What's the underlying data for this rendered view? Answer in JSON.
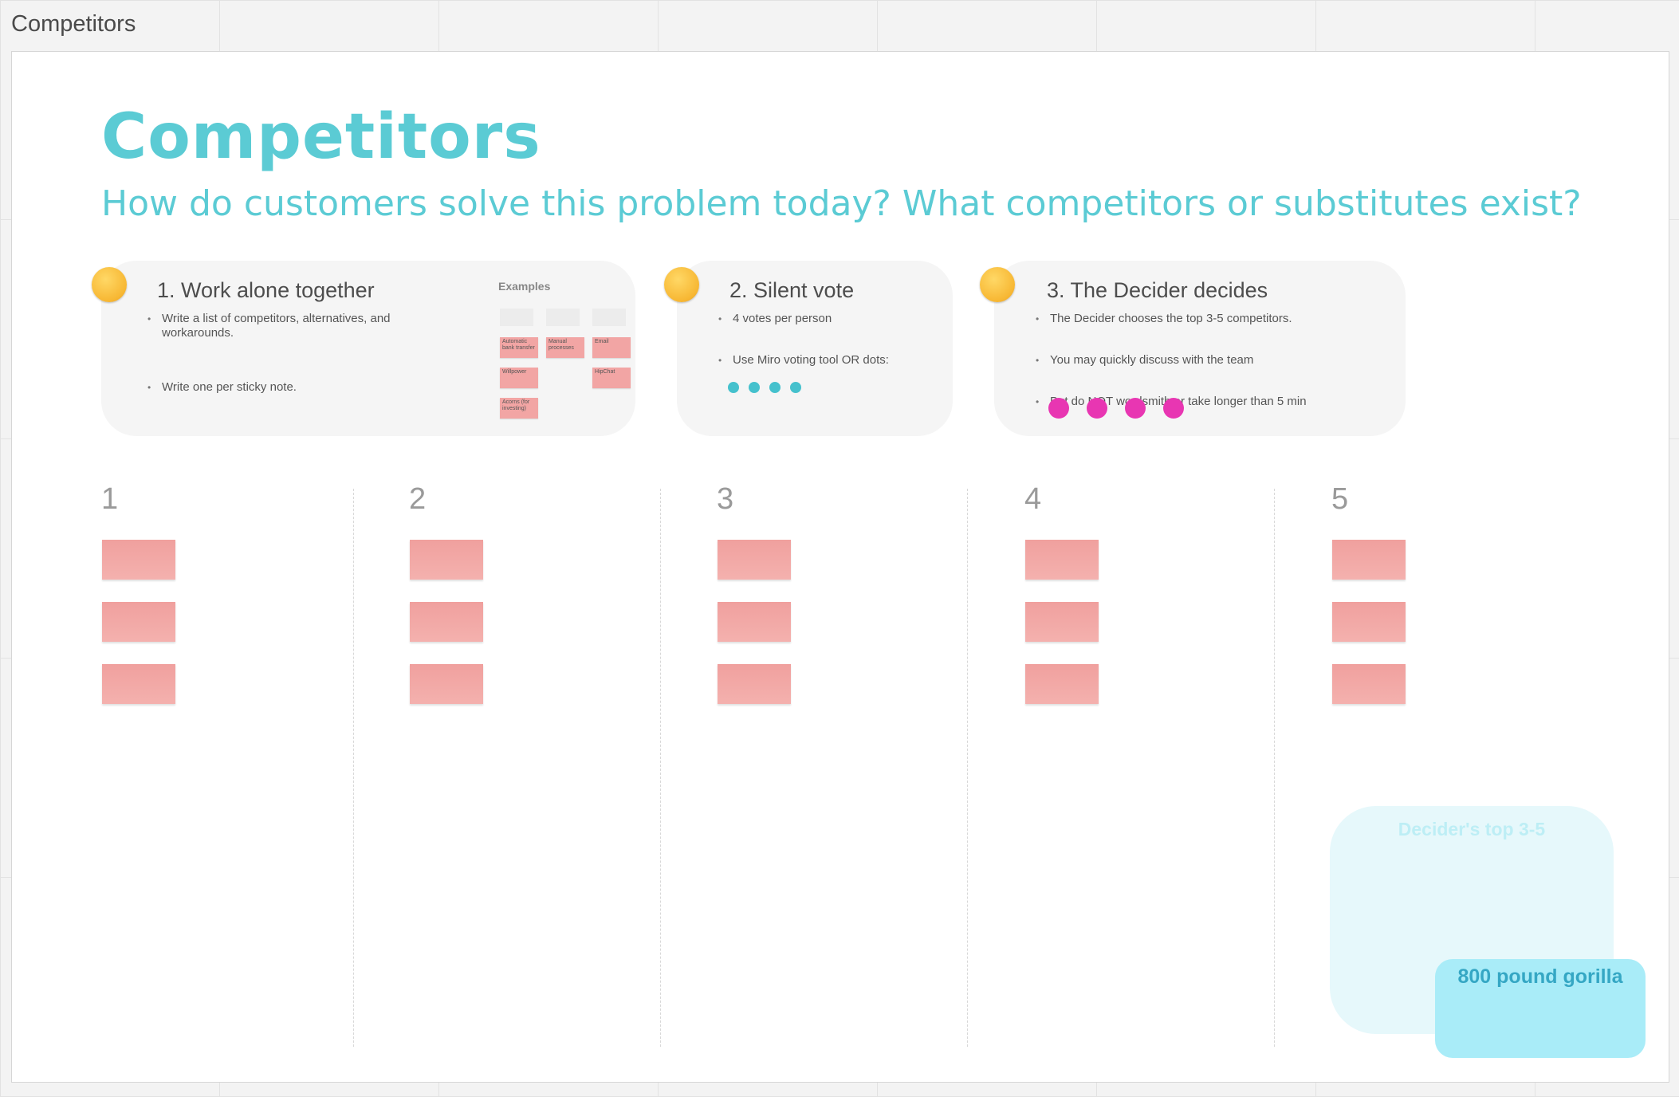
{
  "frame": {
    "label": "Competitors",
    "title": "Competitors",
    "subtitle": "How do customers solve this problem today? What competitors or substitutes exist?"
  },
  "cards": [
    {
      "title": "1. Work alone together",
      "emoji": "shushing-face-icon",
      "bullets": [
        "Write a list of competitors, alternatives, and workarounds.",
        "Write one per sticky note."
      ],
      "examples_label": "Examples",
      "examples": [
        "Automatic bank transfer",
        "Manual processes",
        "Email",
        "Willpower",
        "HipChat",
        "Acorns (for investing)"
      ]
    },
    {
      "title": "2. Silent vote",
      "emoji": "shushing-face-icon",
      "bullets": [
        "4 votes per person",
        "Use Miro voting tool OR dots:"
      ],
      "dot_color": "#45c1cd"
    },
    {
      "title": "3. The Decider decides",
      "emoji": "face-with-monocle-icon",
      "bullets": [
        "The Decider chooses the top 3-5 competitors.",
        "You may quickly discuss with the team",
        "But do NOT wordsmith or take longer than 5 min"
      ],
      "dot_color": "#e836b2"
    }
  ],
  "columns": [
    "1",
    "2",
    "3",
    "4",
    "5"
  ],
  "decider_zone": {
    "label": "Decider's top 3-5"
  },
  "gorilla_note": {
    "label": "800 pound gorilla"
  },
  "colors": {
    "accent": "#5bcbd4",
    "sticky_pink": "#f2a5a4",
    "decider_zone": "#e6f8fb",
    "gorilla": "#a9ecf8"
  }
}
